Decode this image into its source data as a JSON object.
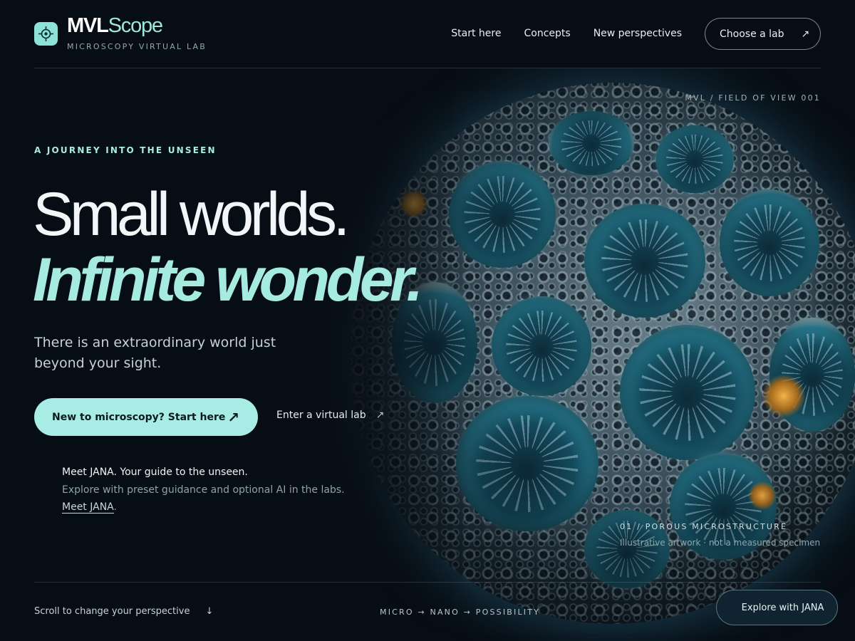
{
  "brand": {
    "name_part1": "MVL",
    "name_part2": "Scope",
    "tagline": "MICROSCOPY VIRTUAL LAB",
    "logo_icon": "crosshair-icon"
  },
  "nav": {
    "items": [
      "Start here",
      "Concepts",
      "New perspectives"
    ],
    "cta_label": "Choose a lab",
    "cta_icon": "arrow-up-right-icon"
  },
  "hero": {
    "field_of_view": "MVL / FIELD OF VIEW 001",
    "eyebrow": "A JOURNEY INTO THE UNSEEN",
    "headline_line1": "Small worlds.",
    "headline_line2": "Infinite wonder.",
    "lead": "There is an extraordinary world just beyond your sight.",
    "primary_cta": "New to microscopy? Start here",
    "secondary_cta": "Enter a virtual lab"
  },
  "jana": {
    "title": "Meet JANA. Your guide to the unseen.",
    "body": "Explore with preset guidance and optional AI in the labs.",
    "link": "Meet JANA",
    "link_suffix": "."
  },
  "caption": {
    "title": "01 / POROUS MICROSTRUCTURE",
    "subtitle": "Illustrative artwork · not a measured specimen"
  },
  "footer": {
    "scroll_hint": "Scroll to change your perspective",
    "scroll_icon": "arrow-down-icon",
    "tagline": "MICRO → NANO → POSSIBILITY",
    "explore_button": "Explore with JANA"
  },
  "colors": {
    "background": "#070d14",
    "accent": "#a6ebe1",
    "logo_bg": "#8de3d8",
    "primary_button": "#a8ece6"
  }
}
